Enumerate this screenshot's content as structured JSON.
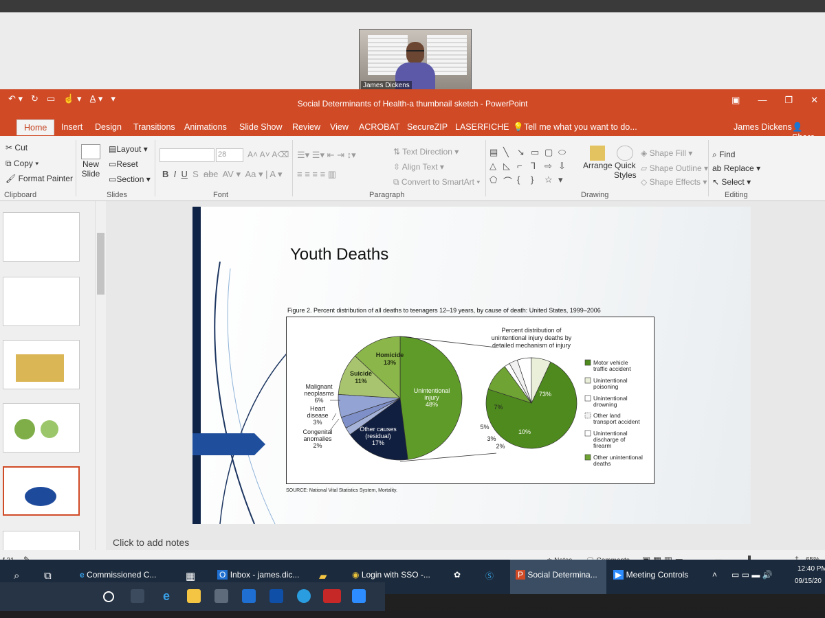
{
  "video": {
    "participant_name": "James Dickens"
  },
  "app": {
    "title": "Social Determinants of Health-a thumbnail sketch - PowerPoint",
    "user": "James Dickens",
    "share": "Share"
  },
  "menu": {
    "tabs": [
      "Home",
      "Insert",
      "Design",
      "Transitions",
      "Animations",
      "Slide Show",
      "Review",
      "View",
      "ACROBAT",
      "SecureZIP",
      "LASERFICHE"
    ],
    "tell_me": "Tell me what you want to do..."
  },
  "ribbon": {
    "clipboard": {
      "cut": "Cut",
      "copy": "Copy",
      "format_painter": "Format Painter",
      "label": "Clipboard"
    },
    "slides": {
      "new_slide_line1": "New",
      "new_slide_line2": "Slide",
      "layout": "Layout",
      "reset": "Reset",
      "section": "Section",
      "label": "Slides"
    },
    "font": {
      "size": "28",
      "label": "Font"
    },
    "paragraph": {
      "text_direction": "Text Direction",
      "align_text": "Align Text",
      "convert_smartart": "Convert to SmartArt",
      "label": "Paragraph"
    },
    "drawing": {
      "arrange": "Arrange",
      "quick_styles_1": "Quick",
      "quick_styles_2": "Styles",
      "shape_fill": "Shape Fill",
      "shape_outline": "Shape Outline",
      "shape_effects": "Shape Effects",
      "label": "Drawing"
    },
    "editing": {
      "find": "Find",
      "replace": "Replace",
      "select": "Select",
      "label": "Editing"
    }
  },
  "slide": {
    "title": "Youth Deaths",
    "figure_caption": "Figure 2. Percent distribution of all deaths to teenagers 12–19 years, by cause of death: United States, 1999–2006",
    "source": "SOURCE: National Vital Statistics System, Mortality.",
    "notes_placeholder": "Click to add notes"
  },
  "chart_data": [
    {
      "type": "pie",
      "title": "",
      "slices": [
        {
          "label": "Unintentional injury",
          "value": 48,
          "color": "#5f9b28"
        },
        {
          "label": "Other causes (residual)",
          "value": 17,
          "color": "#101e3f"
        },
        {
          "label": "Congenital anomalies",
          "value": 2,
          "color": "#a6b3d8"
        },
        {
          "label": "Heart disease",
          "value": 3,
          "color": "#7f90c8"
        },
        {
          "label": "Malignant neoplasms",
          "value": 6,
          "color": "#93a3d4"
        },
        {
          "label": "Suicide",
          "value": 11,
          "color": "#a8c46e"
        },
        {
          "label": "Homicide",
          "value": 13,
          "color": "#8bb64a"
        }
      ]
    },
    {
      "type": "pie",
      "title": "Percent distribution of unintentional injury deaths by detailed mechanism of injury",
      "slices": [
        {
          "label": "Motor vehicle traffic accident",
          "value": 73,
          "color": "#4f8a1e"
        },
        {
          "label": "Other unintentional deaths",
          "value": 10,
          "color": "#6fa334"
        },
        {
          "label": "Unintentional discharge of firearm",
          "value": 2,
          "color": "#ffffff"
        },
        {
          "label": "Other land transport accident",
          "value": 3,
          "color": "#f2f2f2"
        },
        {
          "label": "Unintentional drowning",
          "value": 5,
          "color": "#ffffff"
        },
        {
          "label": "Unintentional poisoning",
          "value": 7,
          "color": "#e9efd8"
        }
      ],
      "legend": [
        "Motor vehicle traffic accident",
        "Unintentional poisoning",
        "Unintentional drowning",
        "Other land transport accident",
        "Unintentional discharge of firearm",
        "Other unintentional deaths"
      ]
    }
  ],
  "pie_labels": {
    "homicide": "Homicide",
    "homicide_pct": "13%",
    "suicide": "Suicide",
    "suicide_pct": "11%",
    "unintentional": "Unintentional",
    "injury": "injury",
    "unintentional_pct": "48%",
    "other_causes": "Other causes",
    "residual": "(residual)",
    "other_pct": "17%",
    "malignant": "Malignant",
    "neoplasms": "neoplasms",
    "malignant_pct": "6%",
    "heart": "Heart",
    "disease": "disease",
    "heart_pct": "3%",
    "congenital": "Congenital",
    "anomalies": "anomalies",
    "congenital_pct": "2%",
    "sub_73": "73%",
    "sub_7": "7%",
    "sub_10": "10%",
    "sub_5": "5%",
    "sub_3": "3%",
    "sub_2": "2%",
    "sub_title_1": "Percent distribution of",
    "sub_title_2": "unintentional injury deaths by",
    "sub_title_3": "detailed mechanism of injury",
    "legend_1a": "Motor vehicle",
    "legend_1b": "traffic accident",
    "legend_2a": "Unintentional",
    "legend_2b": "poisoning",
    "legend_3a": "Unintentional",
    "legend_3b": "drowning",
    "legend_4a": "Other land",
    "legend_4b": "transport accident",
    "legend_5a": "Unintentional",
    "legend_5b": "discharge of",
    "legend_5c": "firearm",
    "legend_6a": "Other unintentional",
    "legend_6b": "deaths"
  },
  "status": {
    "slide_count": "f 31",
    "notes": "Notes",
    "comments": "Comments",
    "zoom": "65%"
  },
  "taskbar": {
    "items": [
      "Commissioned C...",
      "Inbox - james.dic...",
      "Login with SSO -...",
      "Social Determina...",
      "Meeting Controls"
    ],
    "time": "12:40 PM",
    "date": "09/15/20"
  }
}
